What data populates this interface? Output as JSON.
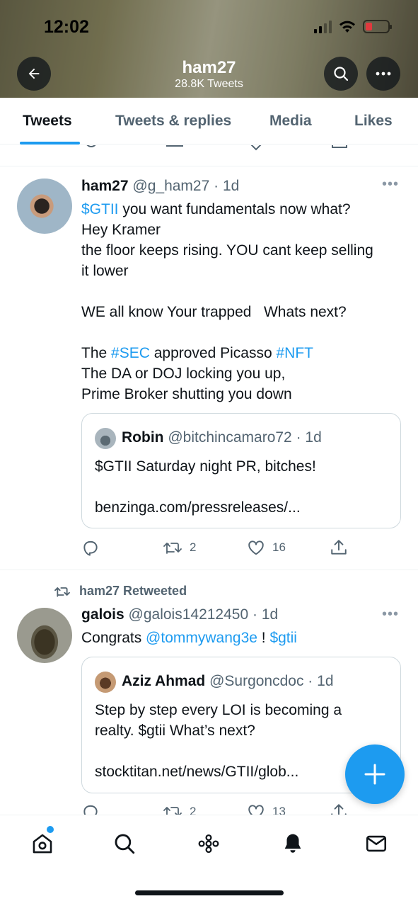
{
  "status_bar": {
    "time": "12:02"
  },
  "header": {
    "title": "ham27",
    "subtitle": "28.8K Tweets"
  },
  "tabs": [
    {
      "label": "Tweets",
      "active": true
    },
    {
      "label": "Tweets & replies",
      "active": false
    },
    {
      "label": "Media",
      "active": false
    },
    {
      "label": "Likes",
      "active": false
    }
  ],
  "tweets": [
    {
      "name": "ham27",
      "handle": "@g_ham27 · 1d",
      "text_parts": {
        "l1_cashtag": "$GTII",
        "l1_rest": " you want fundamentals now what?",
        "l2": "Hey Kramer",
        "l3": "the floor keeps rising. YOU cant keep selling",
        "l4": "it lower",
        "l5": "WE all know Your trapped   Whats next?",
        "l6_a": "The ",
        "l6_hashtag1": "#SEC",
        "l6_b": " approved Picasso ",
        "l6_hashtag2": "#NFT",
        "l7": "The DA or DOJ locking you up,",
        "l8": "Prime Broker shutting you down"
      },
      "quote": {
        "name": "Robin",
        "handle": "@bitchincamaro72 · 1d",
        "line1": "$GTII Saturday night PR, bitches!",
        "line2": "benzinga.com/pressreleases/..."
      },
      "actions": {
        "replies": "",
        "retweets": "2",
        "likes": "16"
      }
    },
    {
      "retweeted_by": "ham27 Retweeted",
      "name": "galois",
      "handle": "@galois14212450 · 1d",
      "text_parts": {
        "a": "Congrats ",
        "mention": "@tommywang3e",
        "b": " ! ",
        "cashtag": "$gtii"
      },
      "quote": {
        "name": "Aziz Ahmad",
        "handle": "@Surgoncdoc · 1d",
        "line1": "Step by step every LOI is becoming a",
        "line2": "realty. $gtii What’s next?",
        "line3": "stocktitan.net/news/GTII/glob..."
      },
      "actions": {
        "replies": "",
        "retweets": "2",
        "likes": "13"
      }
    }
  ],
  "colors": {
    "accent": "#1d9bf0",
    "secondary_text": "#536471",
    "primary_text": "#0f1419"
  },
  "icons": [
    "back-arrow-icon",
    "search-icon",
    "more-icon",
    "reply-icon",
    "retweet-icon",
    "like-icon",
    "share-icon",
    "compose-icon",
    "home-icon",
    "explore-icon",
    "spaces-icon",
    "notifications-icon",
    "messages-icon"
  ]
}
